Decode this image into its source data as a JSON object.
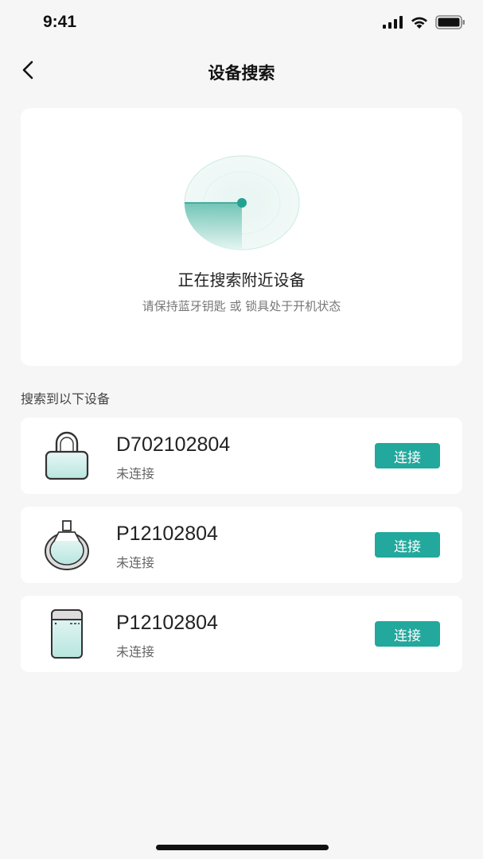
{
  "status_bar": {
    "time": "9:41"
  },
  "nav": {
    "title": "设备搜索"
  },
  "scan": {
    "title": "正在搜索附近设备",
    "subtitle": "请保持蓝牙钥匙 或 锁具处于开机状态"
  },
  "list": {
    "section_label": "搜索到以下设备",
    "devices": [
      {
        "icon": "padlock-icon",
        "name": "D702102804",
        "status": "未连接",
        "button": "连接"
      },
      {
        "icon": "round-lock-icon",
        "name": "P12102804",
        "status": "未连接",
        "button": "连接"
      },
      {
        "icon": "key-device-icon",
        "name": "P12102804",
        "status": "未连接",
        "button": "连接"
      }
    ]
  },
  "colors": {
    "accent": "#22a89c",
    "background": "#f6f6f6"
  }
}
